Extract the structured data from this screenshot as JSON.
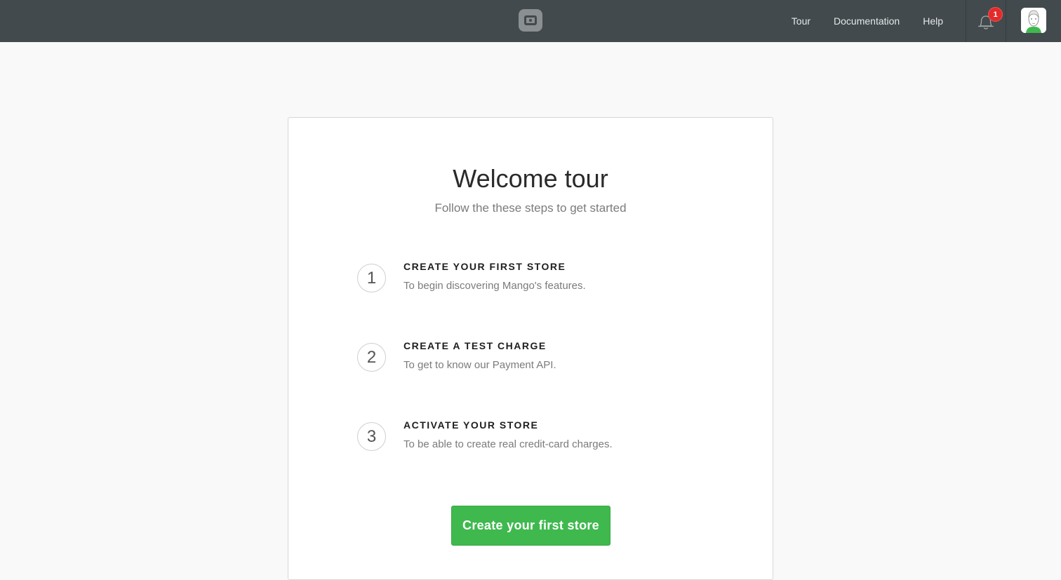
{
  "header": {
    "logo_icon": "logo-icon",
    "nav": [
      {
        "label": "Tour"
      },
      {
        "label": "Documentation"
      },
      {
        "label": "Help"
      }
    ],
    "notifications": {
      "icon": "bell-icon",
      "count": "1"
    },
    "avatar_icon": "user-avatar"
  },
  "main": {
    "title": "Welcome tour",
    "subtitle": "Follow the these steps to get started",
    "steps": [
      {
        "number": "1",
        "title": "CREATE YOUR FIRST STORE",
        "description": "To begin discovering Mango's features."
      },
      {
        "number": "2",
        "title": "CREATE A TEST CHARGE",
        "description": "To get to know our Payment API."
      },
      {
        "number": "3",
        "title": "ACTIVATE YOUR STORE",
        "description": "To be able to create real credit-card charges."
      }
    ],
    "cta_label": "Create your first store"
  },
  "colors": {
    "topbar": "#424a4d",
    "page_background": "#f9f9f9",
    "cta_green": "#3fb94e",
    "badge_red": "#e32b2b"
  }
}
